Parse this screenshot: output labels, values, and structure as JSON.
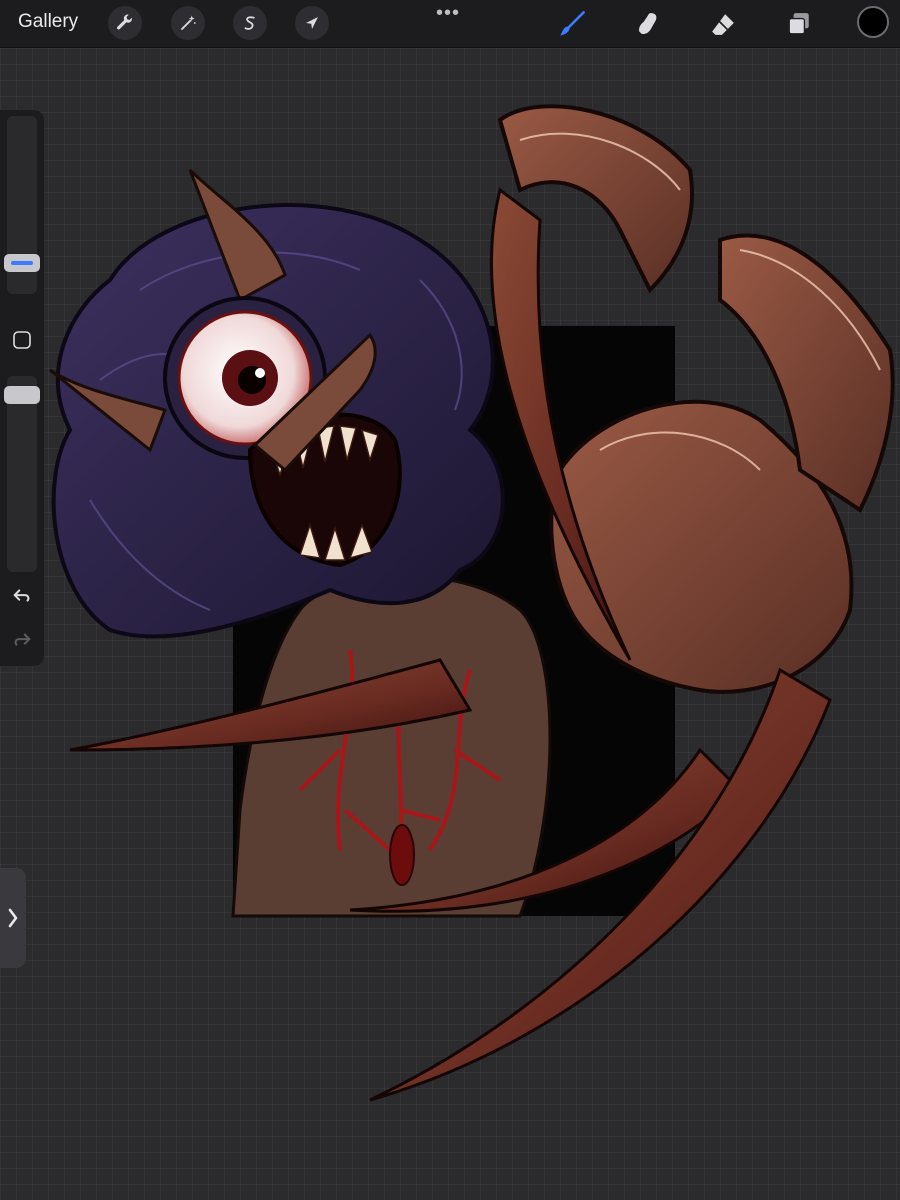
{
  "toolbar": {
    "gallery_label": "Gallery",
    "more_label": "•••",
    "left_tools": [
      "wrench-icon",
      "magic-wand-icon",
      "selection-s-icon",
      "arrow-cursor-icon"
    ],
    "right_tools": [
      "brush-icon",
      "smudge-icon",
      "eraser-icon",
      "layers-icon"
    ],
    "active_tool": "brush-icon",
    "active_color": "#000000",
    "accent_color": "#3a7bff"
  },
  "sidebar": {
    "brush_size_fraction": 0.3,
    "opacity_fraction": 1.0,
    "modify_button_icon": "square-outline-icon",
    "undo_icon": "undo-arrow-icon",
    "redo_icon": "redo-arrow-icon",
    "expand_icon": "chevron-right-icon"
  },
  "canvas": {
    "subject": "monster-illustration",
    "palette": [
      "#3b2f52",
      "#6b3a2a",
      "#a3523b",
      "#b01c1c",
      "#000000"
    ]
  }
}
